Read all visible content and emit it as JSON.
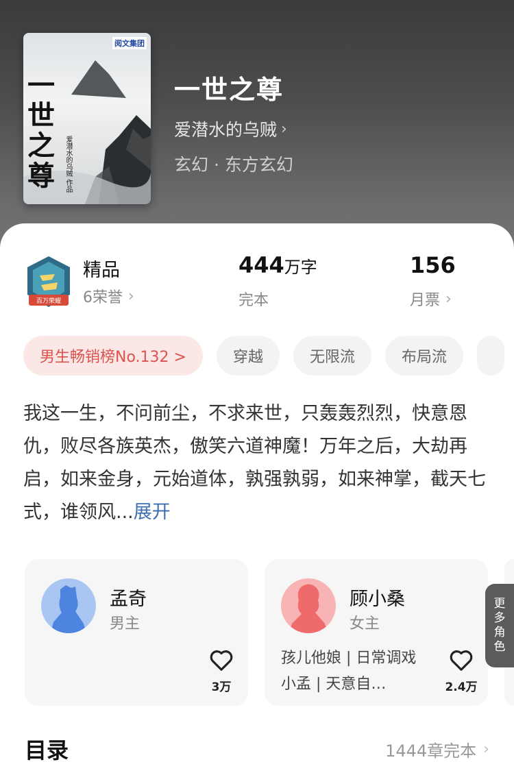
{
  "book": {
    "title": "一世之尊",
    "author": "爱潜水的乌贼",
    "genre": "玄幻 · 东方玄幻",
    "cover": {
      "publisher": "阅文集团",
      "title_art": "一世之尊",
      "author_art": "爱潜水的乌贼 作品"
    }
  },
  "stats": {
    "quality": {
      "value": "精品",
      "label": "6荣誉"
    },
    "badge_text": "百万荣耀",
    "words": {
      "value": "444",
      "unit": "万字",
      "label": "完本"
    },
    "votes": {
      "value": "156",
      "label": "月票"
    }
  },
  "tags": [
    "男生畅销榜No.132 >",
    "穿越",
    "无限流",
    "布局流"
  ],
  "description": {
    "text": "我这一生，不问前尘，不求来世，只轰轰烈烈，快意恩仇，败尽各族英杰，傲笑六道神魔！万年之后，大劫再启，如来金身，元始道体，孰强孰弱，如来神掌，截天七式，谁领风...",
    "expand": "展开"
  },
  "characters": [
    {
      "name": "孟奇",
      "role": "男主",
      "nick": "",
      "likes": "3万"
    },
    {
      "name": "顾小桑",
      "role": "女主",
      "nick": "孩儿他娘 | 日常调戏小孟 | 天意自…",
      "likes": "2.4万"
    }
  ],
  "more_roles": "更多角色",
  "toc": {
    "title": "目录",
    "info": "1444章完本"
  },
  "colors": {
    "accent_red": "#d9534f",
    "link_blue": "#3d6fb3"
  }
}
